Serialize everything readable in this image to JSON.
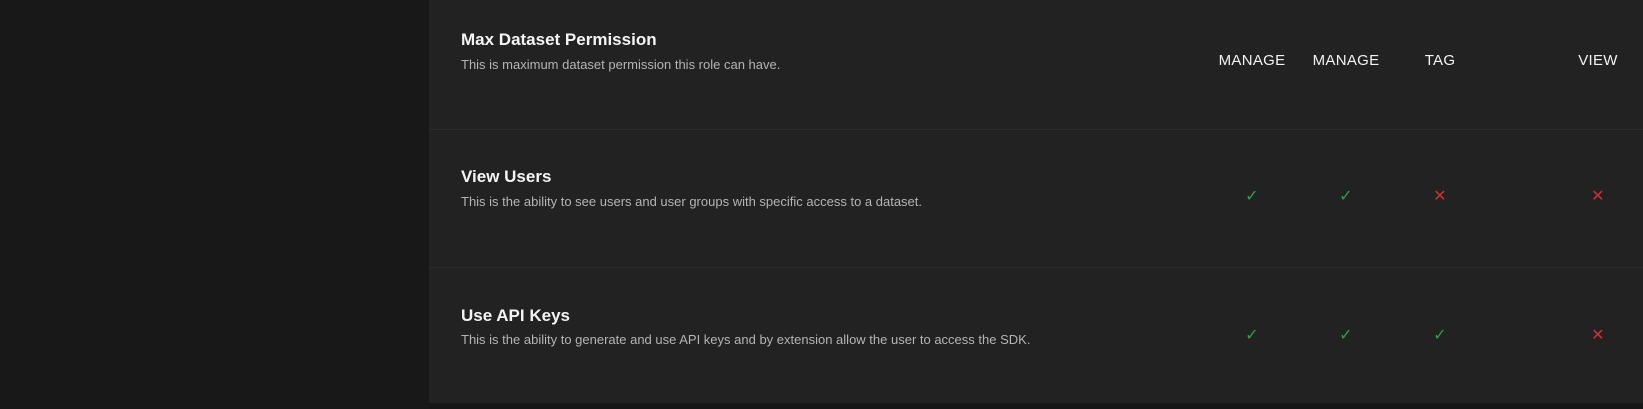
{
  "columns": [
    "MANAGE",
    "MANAGE",
    "TAG",
    "VIEW"
  ],
  "rows": [
    {
      "title": "Max Dataset Permission",
      "description": "This is maximum dataset permission this role can have.",
      "values": [
        "MANAGE",
        "MANAGE",
        "TAG",
        "VIEW"
      ]
    },
    {
      "title": "View Users",
      "description": "This is the ability to see users and user groups with specific access to a dataset.",
      "values": [
        "check",
        "check",
        "cross",
        "cross"
      ]
    },
    {
      "title": "Use API Keys",
      "description": "This is the ability to generate and use API keys and by extension allow the user to access the SDK.",
      "values": [
        "check",
        "check",
        "check",
        "cross"
      ]
    }
  ],
  "icons": {
    "check": "✓",
    "cross": "✕"
  },
  "colors": {
    "check": "#2ea043",
    "cross": "#d0312d"
  }
}
